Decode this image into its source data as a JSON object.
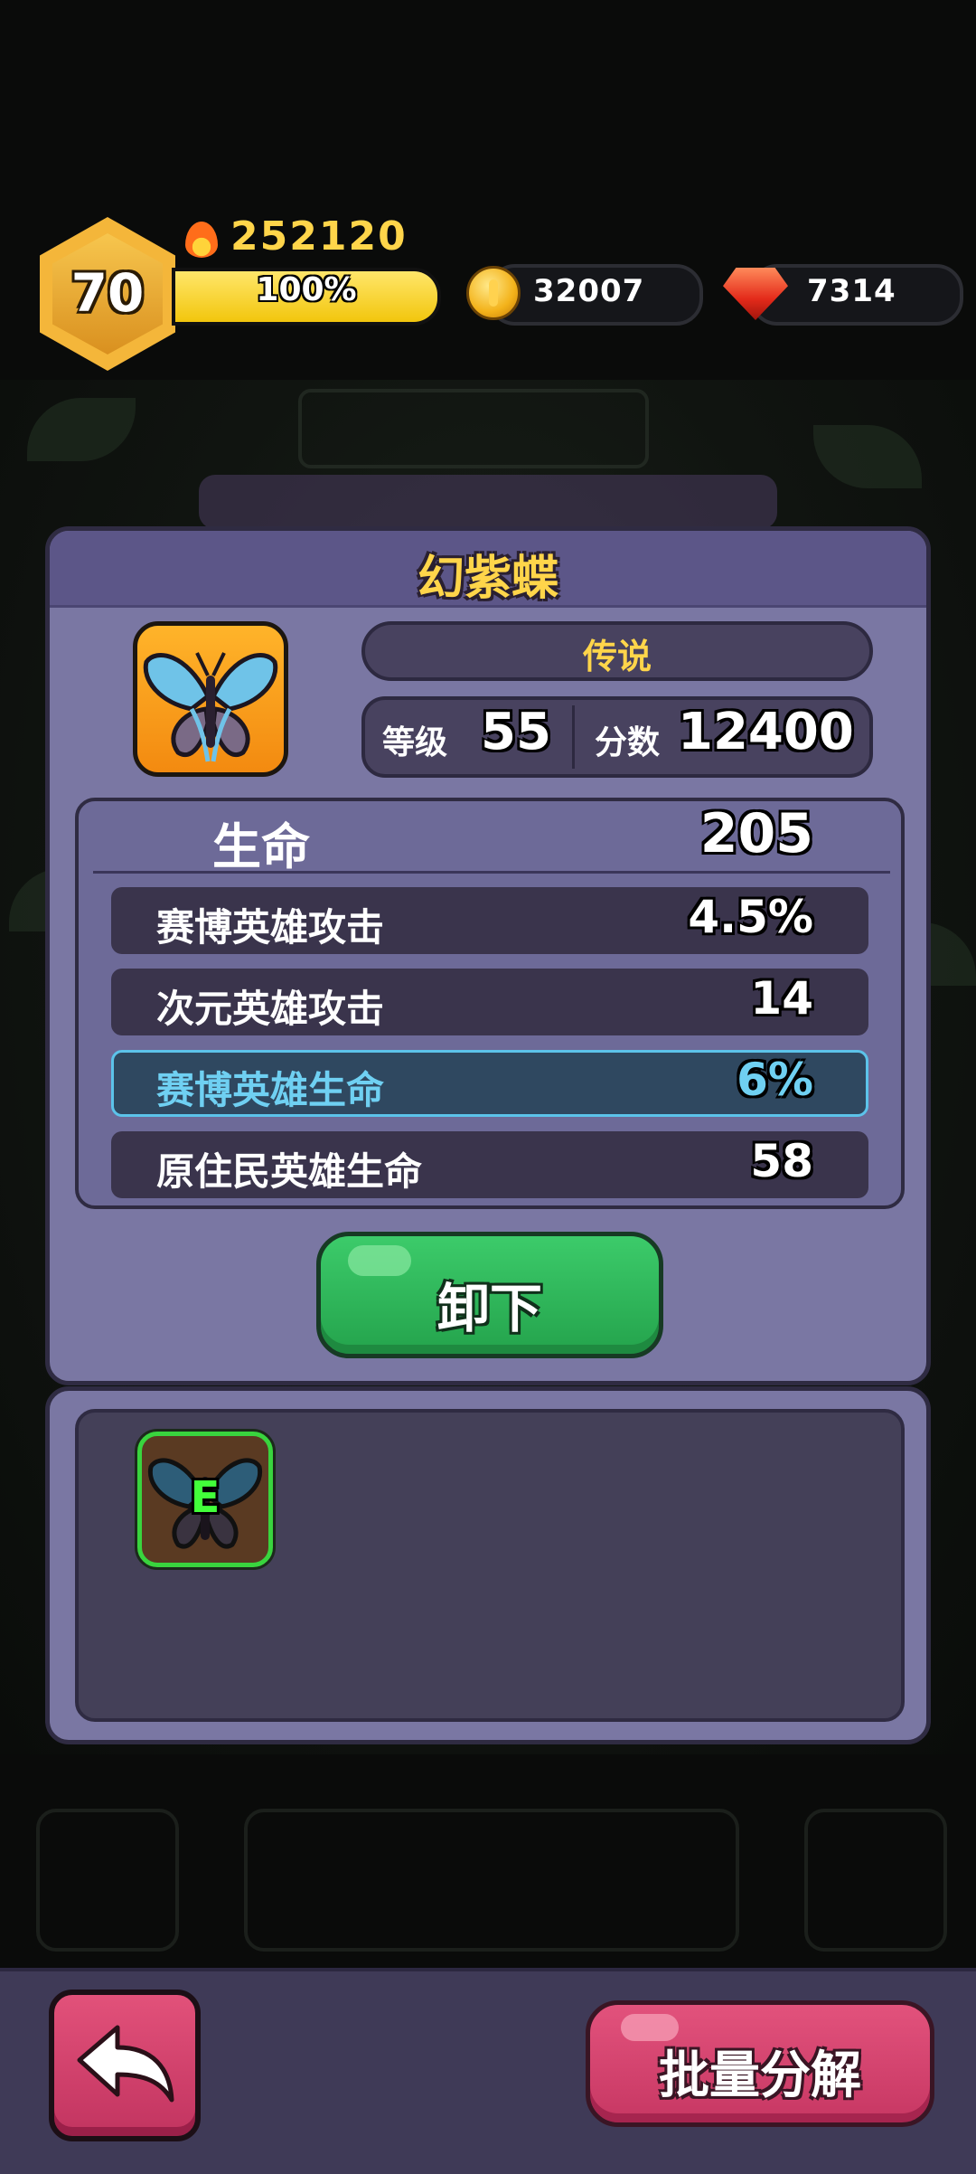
{
  "hud": {
    "level": "70",
    "power": "252120",
    "xp_percent_label": "100%",
    "xp_fraction": 1.0,
    "coins": "32007",
    "gems": "7314",
    "icons": [
      "flame-icon",
      "coin-icon",
      "gem-icon"
    ]
  },
  "item": {
    "name": "幻紫蝶",
    "rarity": "传说",
    "level_label": "等级",
    "level": "55",
    "score_label": "分数",
    "score": "12400",
    "icon": "butterfly-icon",
    "main_stat": {
      "label": "生命",
      "value": "205"
    },
    "sub_stats": [
      {
        "label": "赛博英雄攻击",
        "value": "4.5%",
        "highlight": false
      },
      {
        "label": "次元英雄攻击",
        "value": "14",
        "highlight": false
      },
      {
        "label": "赛博英雄生命",
        "value": "6%",
        "highlight": true
      },
      {
        "label": "原住民英雄生命",
        "value": "58",
        "highlight": false
      }
    ],
    "unequip_label": "卸下"
  },
  "inventory": {
    "items": [
      {
        "grade": "E",
        "icon": "butterfly-icon"
      }
    ]
  },
  "bottom": {
    "back_icon": "back-arrow-icon",
    "salvage_label": "批量分解"
  },
  "colors": {
    "title_gold": "#ffd54a",
    "highlight_cyan": "#6fd0f2",
    "green_button": "#2fb85a",
    "pink_button": "#d6456f",
    "grade_green": "#42ff3a"
  }
}
